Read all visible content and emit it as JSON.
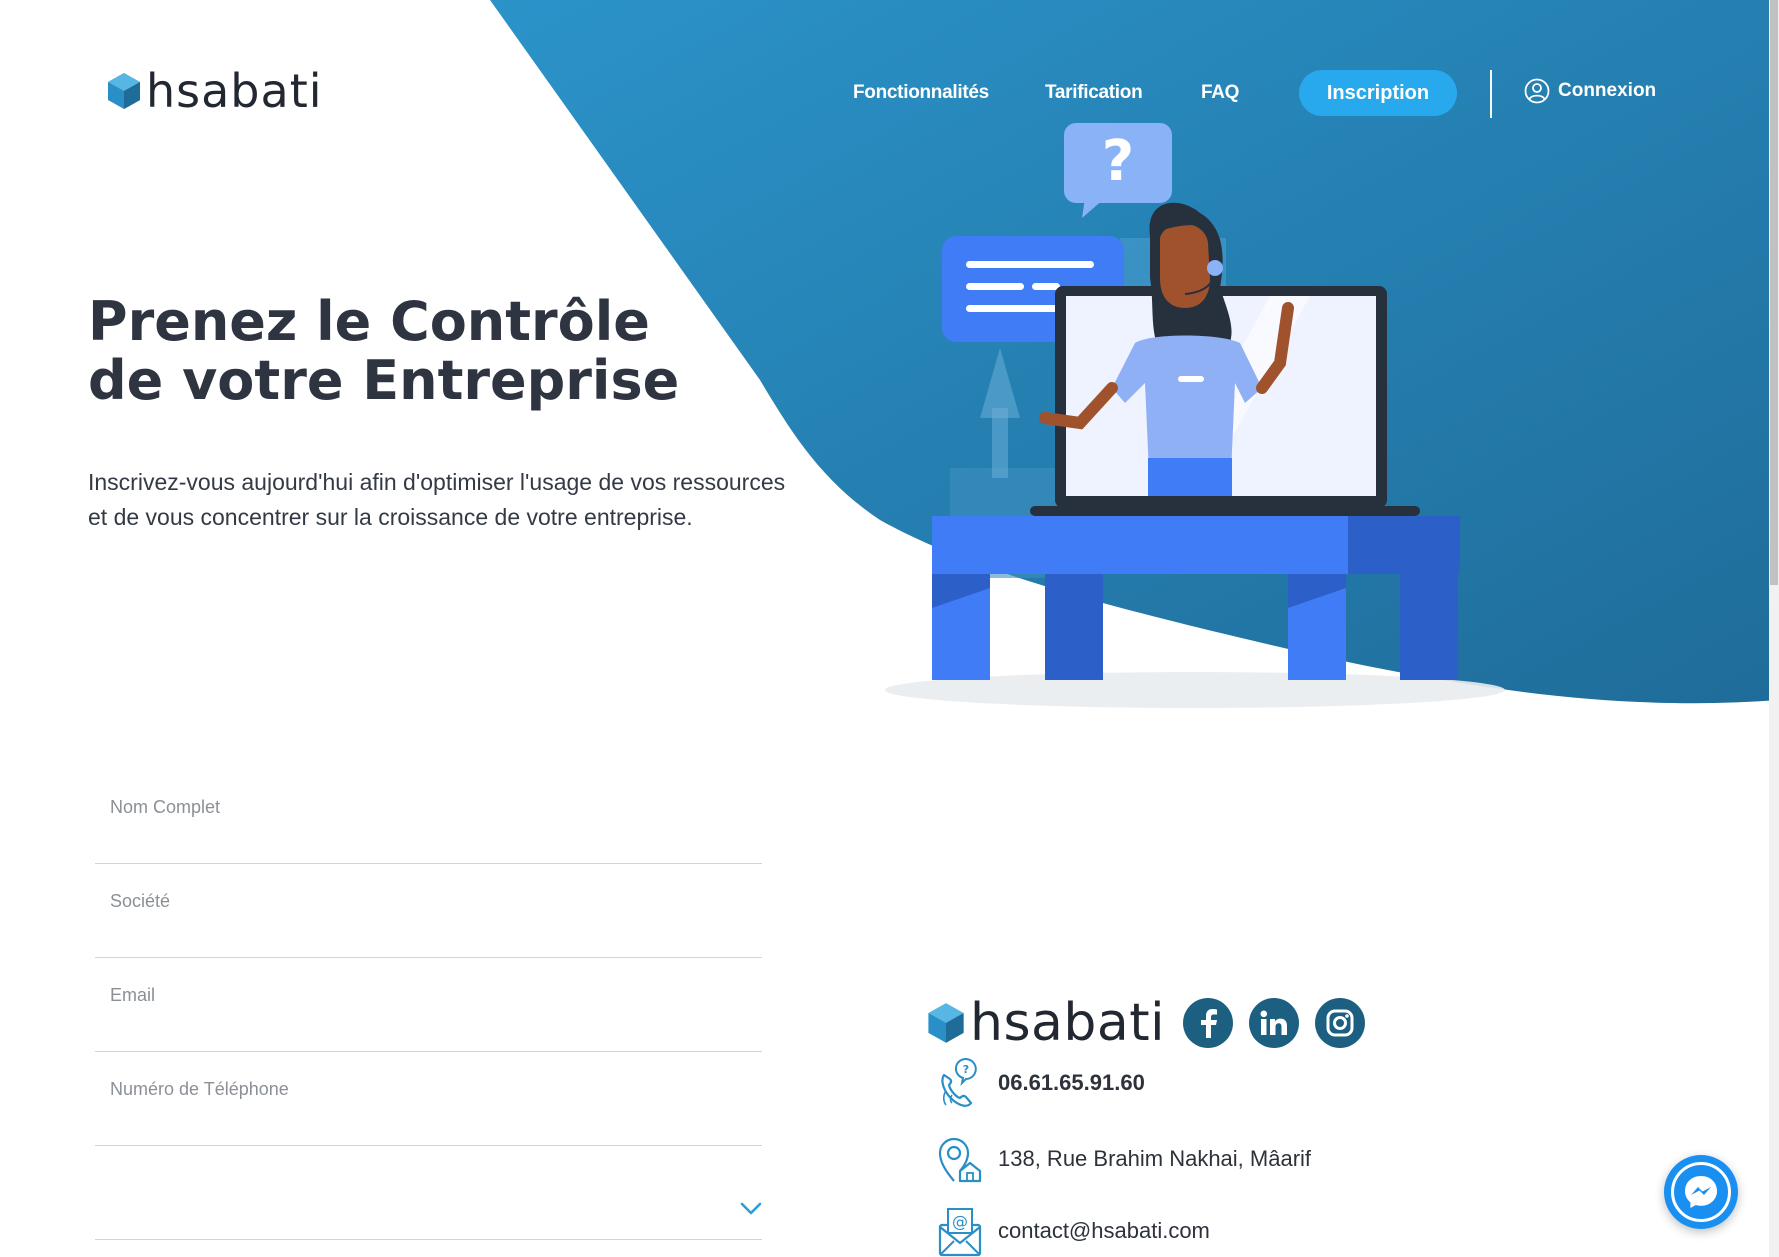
{
  "brand": {
    "name": "hsabati"
  },
  "colors": {
    "hero_gradient_start": "#2a8fc6",
    "hero_gradient_end": "#1e6e9c",
    "cta_blue": "#28a9ee",
    "heading": "#2e3440",
    "illustration_blue": "#3f7cf5"
  },
  "nav": {
    "items": [
      {
        "label": "Fonctionnalités"
      },
      {
        "label": "Tarification"
      },
      {
        "label": "FAQ"
      }
    ],
    "signup_label": "Inscription",
    "login_label": "Connexion",
    "login_icon": "user-circle-icon"
  },
  "hero": {
    "title_line1": "Prenez le Contrôle",
    "title_line2": "de votre Entreprise",
    "subtitle": "Inscrivez-vous aujourd'hui afin d'optimiser l'usage de vos ressources et de vous concentrer sur la croissance de votre entreprise.",
    "illustration": "support-agent-on-laptop-illustration"
  },
  "form": {
    "fields": [
      {
        "placeholder": "Nom Complet",
        "value": ""
      },
      {
        "placeholder": "Société",
        "value": ""
      },
      {
        "placeholder": "Email",
        "value": ""
      },
      {
        "placeholder": "Numéro de Téléphone",
        "value": ""
      }
    ],
    "select": {
      "value": "",
      "icon": "chevron-down-icon"
    }
  },
  "contact": {
    "socials": [
      "facebook-icon",
      "linkedin-icon",
      "instagram-icon"
    ],
    "phone": "06.61.65.91.60",
    "address": "138, Rue Brahim Nakhai, Mâarif",
    "email": "contact@hsabati.com"
  },
  "widgets": {
    "chat_icon": "messenger-icon"
  }
}
